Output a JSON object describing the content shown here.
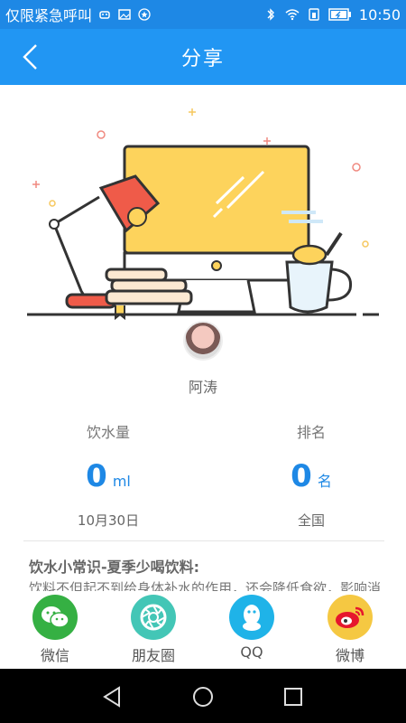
{
  "status_bar": {
    "carrier": "仅限紧急呼叫",
    "time": "10:50"
  },
  "header": {
    "title": "分享"
  },
  "user": {
    "name": "阿涛"
  },
  "stats": {
    "water": {
      "label": "饮水量",
      "value": "0",
      "unit": "ml",
      "date": "10月30日"
    },
    "rank": {
      "label": "排名",
      "value": "0",
      "unit": "名",
      "scope": "全国"
    }
  },
  "tip": {
    "title": "饮水小常识-夏季少喝饮料:",
    "body": "饮料不但起不到给身体补水的作用，还会降低食欲，影响消"
  },
  "share": {
    "wechat": "微信",
    "moments": "朋友圈",
    "qq": "QQ",
    "weibo": "微博"
  },
  "colors": {
    "header": "#2196f3",
    "status": "#1e88e5",
    "accent": "#1e88e5",
    "wechat": "#35b043",
    "moments": "#43c6b6",
    "qq": "#1fb3e8",
    "weibo": "#f5c842"
  }
}
